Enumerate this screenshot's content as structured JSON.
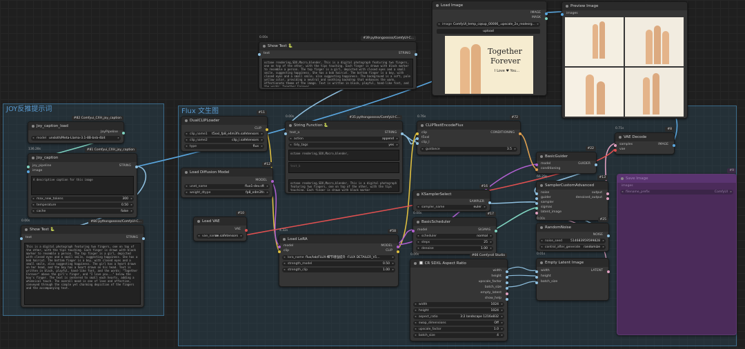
{
  "groups": {
    "joy": "JOY反推提示词",
    "flux": "Flux 文生图"
  },
  "colors": {
    "group_border": "#3b6b8a",
    "wire_yellow": "#e0c040",
    "wire_blue": "#5aa7e0",
    "wire_cyan": "#7fd3c0",
    "wire_purple": "#b060d0",
    "wire_orange": "#e0a050",
    "wire_lightblue": "#8fc0e0"
  },
  "nodes": {
    "load_image": {
      "title": "Load Image",
      "out_image": "IMAGE",
      "out_mask": "MASK",
      "image_label": "image",
      "image_value": "ComfyUI_temp_cqsup_00006_.upscale_2x_realesrg...",
      "upload": "upload",
      "preview_title": "Together",
      "preview_sub": "Forever",
      "preview_small": "I Love ♥ You..."
    },
    "preview_image": {
      "title": "Preview Image",
      "in_images": "images"
    },
    "show_text_top": {
      "time": "0.00s",
      "title": "Show Text 🐍",
      "id": "#39 pythongosssss/ComfyUI-C...",
      "in_text": "text",
      "out_string": "STRING",
      "content": "octane rendering,SDX,Macro,blender, This is a digital photograph featuring two fingers, one on top of the other, with the tips touching. Each finger is drawn with black marker to resemble a person. The top finger is a girl, depicted with closed eyes and a small smile, suggesting happiness. She has a bob haircut. The bottom finger is a boy, with closed eyes and a small smile, also suggesting happiness. The background is a soft, pale yellow color, providing a neutral and soothing backdrop that enhances the warm, affectionate theme of the image. Text is written in black, playful, hand-like font, and the words: Together Forever"
    },
    "joy_caption_load": {
      "id": "#82 Comfyui_CXH_joy_caption",
      "title": "Joy_caption_load",
      "out": "JoyPipeline",
      "model_label": "model",
      "model_value": "unsloth/Meta-Llama-3.1-8B-bnb-4bit"
    },
    "joy_caption": {
      "time": "136.28s",
      "id": "#81 Comfyui_CXH_joy_caption",
      "title": "Joy_caption",
      "in_pipeline": "joy_pipeline",
      "in_image": "image",
      "out": "STRING",
      "prompt": "A descriptive caption for this image",
      "max_new_tokens_label": "max_new_tokens",
      "max_new_tokens": "300",
      "temperature_label": "temperature",
      "temperature": "0.50",
      "cache_label": "cache",
      "cache": "false"
    },
    "show_text_left": {
      "time": "0.00s",
      "title": "Show Text 🐍",
      "id": "#80 pythongosssss/ComfyUI-C...",
      "in_text": "text",
      "out": "STRING",
      "content": "This is a digital photograph featuring two fingers, one on top of the other, with the tips touching. Each finger is drawn with black marker to resemble a person. The top finger is a girl, depicted with closed eyes and a small smile, suggesting happiness. She has a bob haircut. The bottom finger is a boy, with closed eyes and a small smile, also suggesting happiness. The girl has a heart drawn on her head, and the boy has a heart drawn on his head. Text is written in black, playful, hand-like font, and the words: \"Together Forever\" above the girl's finger, and \"I love you...\" below the boy's finger. The text is centered to small each hearts, adding a whimsical touch. The overall mood is one of love and affection, conveyed through the simple yet charming depiction of the fingers and the accompanying text."
    },
    "dual_clip": {
      "id": "#11",
      "title": "DualCLIPLoader",
      "out": "CLIP",
      "clip1_label": "clip_name1",
      "clip1": "t5xxl_fp8_e4m3fn.safetensors",
      "clip2_label": "clip_name2",
      "clip2": "clip_l.safetensors",
      "type_label": "type",
      "type": "flux"
    },
    "load_diffusion": {
      "id": "#12",
      "title": "Load Diffusion Model",
      "out": "MODEL",
      "unet_label": "unet_name",
      "unet": "flux1-dev.sft",
      "dtype_label": "weight_dtype",
      "dtype": "fp8_e4m3fn"
    },
    "load_vae": {
      "id": "#10",
      "title": "Load VAE",
      "out": "VAE",
      "vae_label": "vae_name",
      "vae": "ae.safetensors"
    },
    "string_function": {
      "time": "0.00s",
      "id": "#35 pythongosssss/ComfyUI-C...",
      "title": "String Function 🐍",
      "in_a": "text_a",
      "out": "STRING",
      "action_label": "action",
      "action": "append",
      "tidy_label": "tidy_tags",
      "tidy": "yes",
      "text_a_value": "octane rendering,SDX,Macro,blender,",
      "text_b_placeholder": "text_b",
      "text_c_value": "octane rendering,SDX,Macro,blender, This is a digital photograph featuring two fingers, one on top of the other, with the tips touching. Each finger is drawn with black marker"
    },
    "load_lora": {
      "time": "4.32s",
      "id": "#58",
      "title": "Load LoRA",
      "in_model": "model",
      "in_clip": "clip",
      "out_model": "MODEL",
      "out_clip": "CLIP",
      "lora_label": "lora_name",
      "lora": "flux/lab/FLUX-细节增强提升 -FLUX DETAILER_V1...",
      "sm_label": "strength_model",
      "sm": "0.50",
      "sc_label": "strength_clip",
      "sc": "1.00"
    },
    "clip_text_encode": {
      "time": "0.76s",
      "id": "#72",
      "title": "CLIPTextEncodeFlux",
      "in_clip": "clip",
      "in_t5": "t5xxl",
      "in_clipl": "clip_l",
      "out": "CONDITIONING",
      "guidance_label": "guidance",
      "guidance": "3.5"
    },
    "vae_decode": {
      "time": "0.71s",
      "id": "#8",
      "title": "VAE Decode",
      "in_samples": "samples",
      "in_vae": "vae",
      "out": "IMAGE"
    },
    "basic_guider": {
      "id": "#22",
      "title": "BasicGuider",
      "in_model": "model",
      "in_cond": "conditioning",
      "out": "GUIDER"
    },
    "sampler_custom": {
      "time": "66.29s",
      "id": "#13",
      "title": "SamplerCustomAdvanced",
      "in_noise": "noise",
      "in_guider": "guider",
      "in_sampler": "sampler",
      "in_sigmas": "sigmas",
      "in_latent": "latent_image",
      "out_output": "output",
      "out_denoised": "denoised_output"
    },
    "ksampler_select": {
      "id": "#16",
      "title": "KSamplerSelect",
      "out": "SAMPLER",
      "sampler_label": "sampler_name",
      "sampler": "euler"
    },
    "basic_scheduler": {
      "time": "0.00s",
      "id": "#17",
      "title": "BasicScheduler",
      "in_model": "model",
      "out": "SIGMAS",
      "scheduler_label": "scheduler",
      "scheduler": "normal",
      "steps_label": "steps",
      "steps": "25",
      "denoise_label": "denoise",
      "denoise": "1.00"
    },
    "random_noise": {
      "time": "0.00s",
      "id": "#25",
      "title": "RandomNoise",
      "out": "NOISE",
      "seed_label": "noise_seed",
      "seed": "514683959599828",
      "cag_label": "control_after_generate",
      "cag": "randomize"
    },
    "empty_latent": {
      "time": "0.01s",
      "title": "Empty Latent Image",
      "in_width": "width",
      "in_height": "height",
      "in_batch": "batch_size",
      "out": "LATENT"
    },
    "sdxl_aspect": {
      "time": "0.00s",
      "id": "#66 Comfyroll Studio",
      "title": "🔲 CR SDXL Aspect Ratio",
      "out_width": "width",
      "out_height": "height",
      "out_upscale": "upscale_factor",
      "out_batch": "batch_size",
      "out_empty": "empty_latent",
      "out_help": "show_help",
      "width_label": "width",
      "width": "1024",
      "height_label": "height",
      "height": "1024",
      "ar_label": "aspect_ratio",
      "ar": "3:2 landscape 1216x832",
      "swap_label": "swap_dimensions",
      "swap": "Off",
      "up_label": "upscale_factor",
      "up": "1.0",
      "batch_label": "batch_size",
      "batch": "4"
    },
    "save_image": {
      "id": "#9",
      "title": "Save Image",
      "in_images": "images",
      "prefix_label": "filename_prefix",
      "prefix": "ComfyUI"
    }
  }
}
